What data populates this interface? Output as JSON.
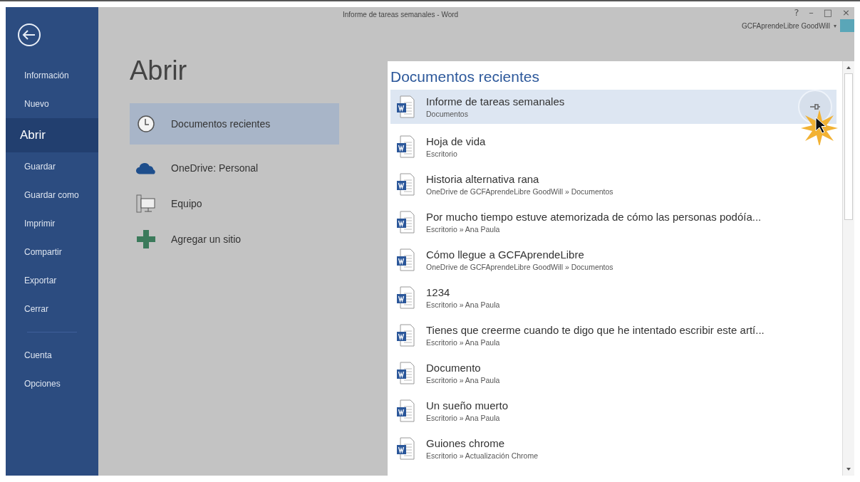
{
  "window": {
    "title": "Informe de tareas semanales - Word",
    "controls": [
      "?",
      "–",
      "□",
      "×"
    ],
    "account": "GCFAprendeLibre GoodWill",
    "account_caret": "▾"
  },
  "sidebar": {
    "items": [
      {
        "label": "Información",
        "selected": false
      },
      {
        "label": "Nuevo",
        "selected": false
      },
      {
        "label": "Abrir",
        "selected": true
      },
      {
        "label": "Guardar",
        "selected": false
      },
      {
        "label": "Guardar como",
        "selected": false
      },
      {
        "label": "Imprimir",
        "selected": false
      },
      {
        "label": "Compartir",
        "selected": false
      },
      {
        "label": "Exportar",
        "selected": false
      },
      {
        "label": "Cerrar",
        "selected": false
      }
    ],
    "footer_items": [
      {
        "label": "Cuenta",
        "selected": false
      },
      {
        "label": "Opciones",
        "selected": false
      }
    ]
  },
  "heading": "Abrir",
  "places": [
    {
      "kind": "clock",
      "label": "Documentos recientes",
      "selected": true
    },
    {
      "kind": "cloud",
      "label": "OneDrive: Personal",
      "selected": false
    },
    {
      "kind": "computer",
      "label": "Equipo",
      "selected": false
    },
    {
      "kind": "add",
      "label": "Agregar un sitio",
      "selected": false
    }
  ],
  "recent": {
    "title": "Documentos recientes",
    "documents": [
      {
        "name": "Informe de tareas semanales",
        "path": "Documentos",
        "selected": true
      },
      {
        "name": "Hoja de vida",
        "path": "Escritorio",
        "selected": false
      },
      {
        "name": "Historia alternativa rana",
        "path": "OneDrive de GCFAprendeLibre GoodWill » Documentos",
        "selected": false
      },
      {
        "name": "Por mucho tiempo estuve atemorizada de  cómo las personas podóía...",
        "path": "Escritorio » Ana Paula",
        "selected": false
      },
      {
        "name": "Cómo llegue a GCFAprendeLibre",
        "path": "OneDrive de GCFAprendeLibre GoodWill » Documentos",
        "selected": false
      },
      {
        "name": "1234",
        "path": "Escritorio » Ana Paula",
        "selected": false
      },
      {
        "name": "Tienes que creerme cuando te digo que he intentado escribir este artí...",
        "path": "Escritorio » Ana Paula",
        "selected": false
      },
      {
        "name": "Documento",
        "path": "Escritorio » Ana Paula",
        "selected": false
      },
      {
        "name": "Un sueño muerto",
        "path": "Escritorio » Ana Paula",
        "selected": false
      },
      {
        "name": "Guiones chrome",
        "path": "Escritorio » Actualización Chrome",
        "selected": false
      }
    ]
  }
}
